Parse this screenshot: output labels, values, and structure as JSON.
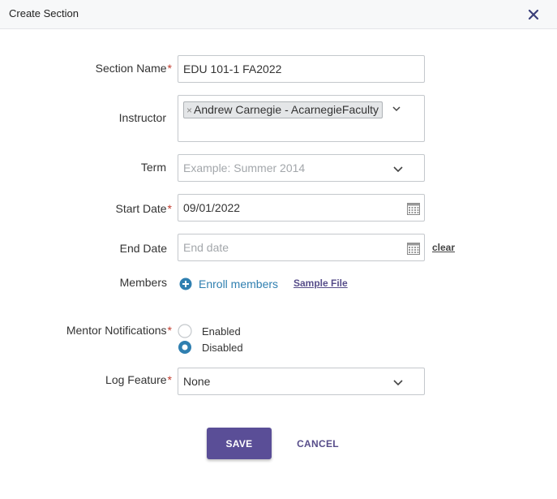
{
  "dialog": {
    "title": "Create Section",
    "close_icon": "close-icon"
  },
  "form": {
    "section_name": {
      "label": "Section Name",
      "required": "*",
      "value": "EDU 101-1 FA2022"
    },
    "instructor": {
      "label": "Instructor",
      "tag_remove": "×",
      "selected": "Andrew Carnegie - AcarnegieFaculty"
    },
    "term": {
      "label": "Term",
      "placeholder": "Example: Summer 2014"
    },
    "start_date": {
      "label": "Start Date",
      "required": "*",
      "value": "09/01/2022",
      "icon": "calendar-icon"
    },
    "end_date": {
      "label": "End Date",
      "placeholder": "End date",
      "icon": "calendar-icon",
      "clear_label": "clear"
    },
    "members": {
      "label": "Members",
      "enroll_label": "Enroll members",
      "enroll_icon": "plus-circle-icon",
      "sample_file_label": "Sample File"
    },
    "mentor_notifications": {
      "label": "Mentor Notifications",
      "required": "*",
      "options": [
        {
          "label": "Enabled",
          "selected": false
        },
        {
          "label": "Disabled",
          "selected": true
        }
      ]
    },
    "log_feature": {
      "label": "Log Feature",
      "required": "*",
      "value": "None"
    }
  },
  "actions": {
    "save_label": "SAVE",
    "cancel_label": "CANCEL"
  },
  "colors": {
    "accent": "#5a4e97",
    "link": "#2f7fb0",
    "required": "#c0392b",
    "radio_selected": "#2f7fb0"
  }
}
